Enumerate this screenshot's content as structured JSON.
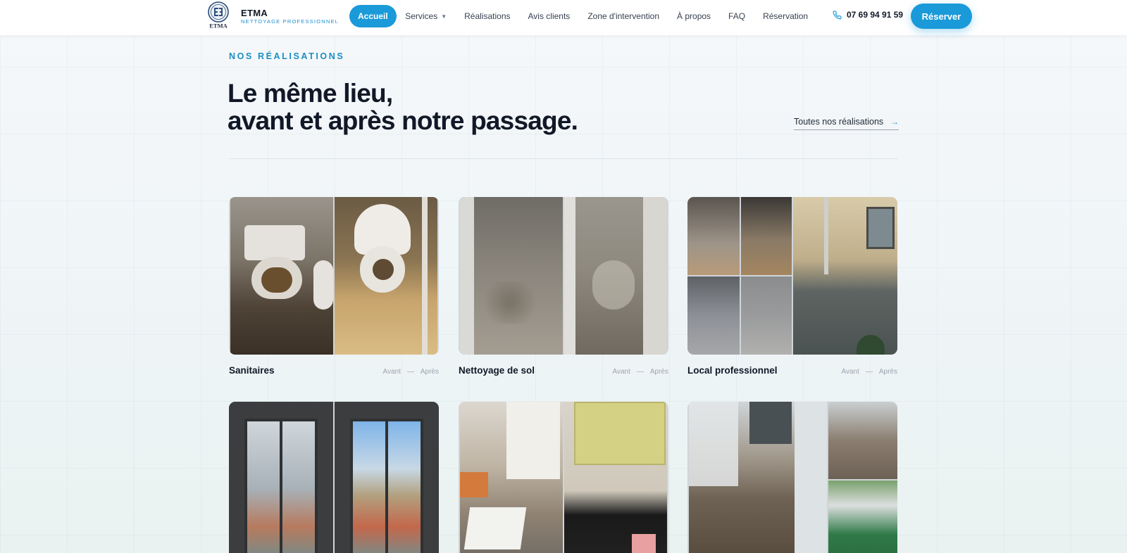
{
  "brand": {
    "name": "ETMA",
    "tagline": "NETTOYAGE PROFESSIONNEL",
    "logo_text": "ETMA"
  },
  "nav": {
    "items": [
      {
        "label": "Accueil",
        "active": true
      },
      {
        "label": "Services",
        "dropdown": true
      },
      {
        "label": "Réalisations"
      },
      {
        "label": "Avis clients"
      },
      {
        "label": "Zone d'intervention"
      },
      {
        "label": "À propos"
      },
      {
        "label": "FAQ"
      },
      {
        "label": "Réservation"
      }
    ],
    "phone": "07 69 94 91 59",
    "cta": "Réserver"
  },
  "section": {
    "eyebrow": "NOS RÉALISATIONS",
    "headline_line1": "Le même lieu,",
    "headline_line2": "avant et après notre passage.",
    "all_link": "Toutes nos réalisations"
  },
  "cards": [
    {
      "title": "Sanitaires",
      "before": "Avant",
      "after": "Après"
    },
    {
      "title": "Nettoyage de sol",
      "before": "Avant",
      "after": "Après"
    },
    {
      "title": "Local professionnel",
      "before": "Avant",
      "after": "Après"
    },
    {
      "title": "",
      "before": "",
      "after": ""
    },
    {
      "title": "",
      "before": "",
      "after": ""
    },
    {
      "title": "",
      "before": "",
      "after": ""
    }
  ],
  "colors": {
    "accent": "#1a9ad9",
    "eyebrow": "#1a8fc2",
    "text": "#111827"
  }
}
